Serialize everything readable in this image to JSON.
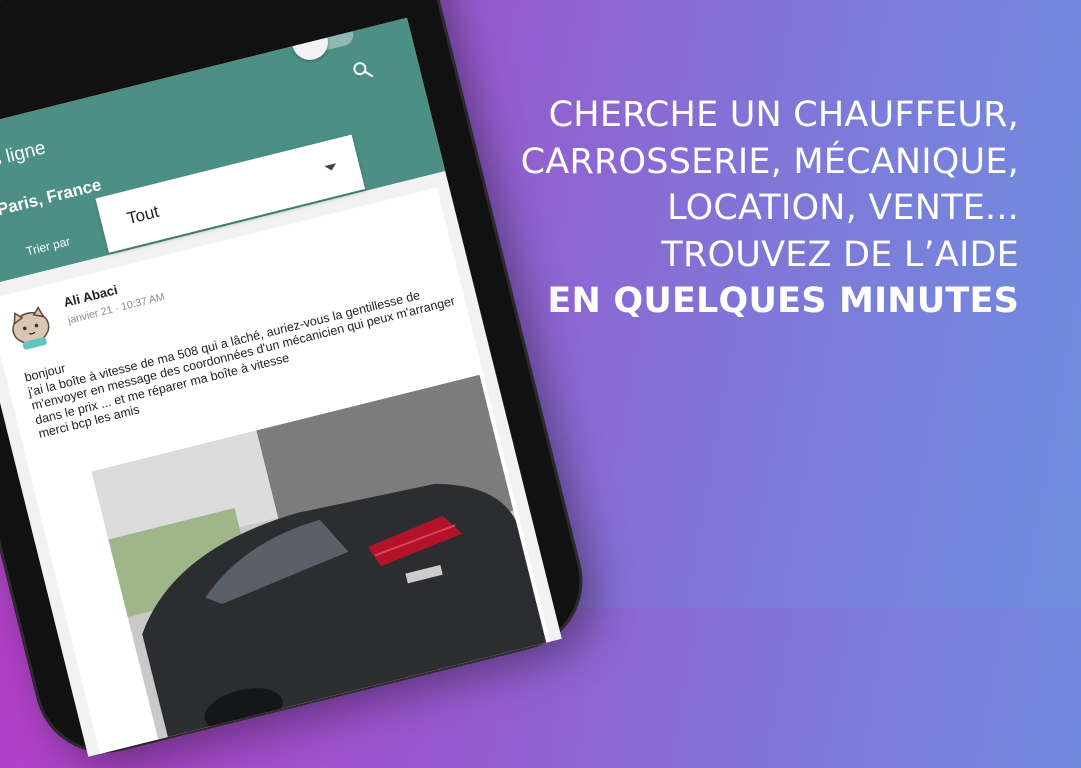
{
  "promo": {
    "lines": [
      "CHERCHE UN CHAUFFEUR,",
      "CARROSSERIE, MÉCANIQUE,",
      "LOCATION, VENTE...",
      "TROUVEZ DE L’AIDE"
    ],
    "highlight": "EN QUELQUES MINUTES"
  },
  "app": {
    "status_label": "Hors ligne",
    "location": "Paris, France",
    "sort": {
      "label": "Trier par",
      "selected": "Tout"
    },
    "icons": {
      "search": "search-icon",
      "dropdown": "chevron-down-icon"
    },
    "colors": {
      "appbar": "#4b8f85",
      "background_start": "#b23fc6",
      "background_end": "#6f8ee0"
    }
  },
  "post": {
    "author": "Ali Abaci",
    "date": "janvier 21 · 10:37 AM",
    "body": "bonjour\nj'ai la boîte à vitesse de ma 508 qui a lâché, auriez-vous la gentillesse de m'envoyer en message des coordonnées d'un mécanicien qui peux m'arranger dans le prix ... et me réparer ma boîte à vitesse\nmerci bcp les amis"
  }
}
